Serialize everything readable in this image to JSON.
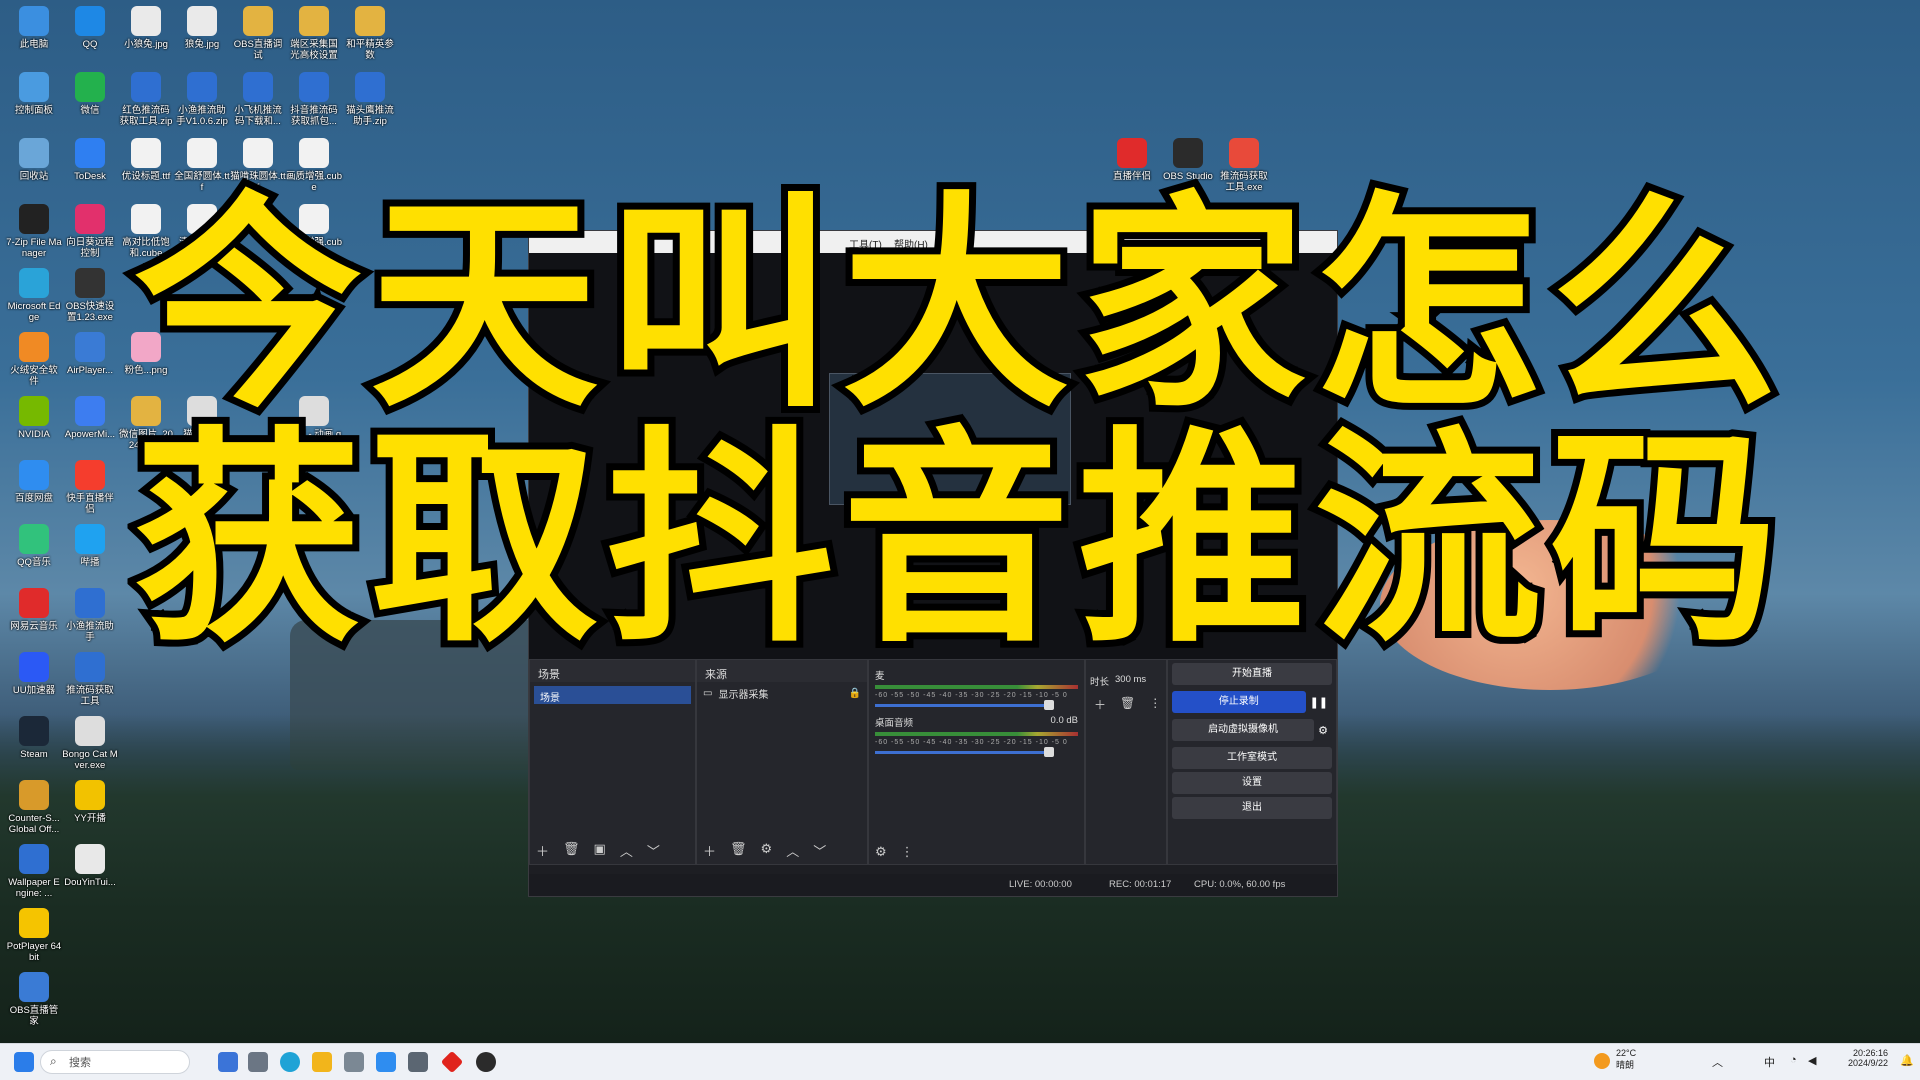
{
  "desktop_icons": [
    {
      "label": "此电脑",
      "color": "#3b8fe0"
    },
    {
      "label": "QQ",
      "color": "#1e88e5"
    },
    {
      "label": "小狼兔.jpg",
      "color": "#eaeaea"
    },
    {
      "label": "狼兔.jpg",
      "color": "#eaeaea"
    },
    {
      "label": "OBS直播调试",
      "color": "#e3b341"
    },
    {
      "label": "端区采集国光高校设置",
      "color": "#e3b341"
    },
    {
      "label": "和平精英参数",
      "color": "#e3b341"
    },
    {
      "label": "控制面板",
      "color": "#4a9be0"
    },
    {
      "label": "微信",
      "color": "#23b14d"
    },
    {
      "label": "红色推流码获取工具.zip",
      "color": "#2f6fd1"
    },
    {
      "label": "小渔推流助手V1.0.6.zip",
      "color": "#2f6fd1"
    },
    {
      "label": "小飞机推流码下载和...",
      "color": "#2f6fd1"
    },
    {
      "label": "抖音推流码获取抓包...",
      "color": "#2f6fd1"
    },
    {
      "label": "猫头鹰推流助手.zip",
      "color": "#2f6fd1"
    },
    {
      "label": "回收站",
      "color": "#6aa6d8"
    },
    {
      "label": "ToDesk",
      "color": "#2f7ff1"
    },
    {
      "label": "优设标题.ttf",
      "color": "#f2f2f2"
    },
    {
      "label": "全国舒圆体.ttf",
      "color": "#f2f2f2"
    },
    {
      "label": "猫啃珠圆体.ttf",
      "color": "#f2f2f2"
    },
    {
      "label": "画质增强.cube",
      "color": "#f2f2f2"
    },
    {
      "label": "7-Zip File Manager",
      "color": "#222"
    },
    {
      "label": "向日葵远程控制",
      "color": "#e2306c"
    },
    {
      "label": "高对比低饱和.cube",
      "color": "#f2f2f2"
    },
    {
      "label": "清新暖调...",
      "color": "#f2f2f2"
    },
    {
      "label": "画质增强.cube",
      "color": "#f2f2f2"
    },
    {
      "label": "Microsoft Edge",
      "color": "#2aa3d8"
    },
    {
      "label": "OBS快速设置1.23.exe",
      "color": "#333"
    },
    {
      "label": "火绒安全软件",
      "color": "#f08a24"
    },
    {
      "label": "AirPlayer...",
      "color": "#3a7bd5"
    },
    {
      "label": "粉色...png",
      "color": "#f2a7c7"
    },
    {
      "label": "NVIDIA",
      "color": "#76b900"
    },
    {
      "label": "ApowerMi...",
      "color": "#3d7df0"
    },
    {
      "label": "微信图片_2024030...",
      "color": "#e3b341"
    },
    {
      "label": "猫咪.GIF",
      "color": "#ddd"
    },
    {
      "label": "画面 - 动画.gif",
      "color": "#ddd"
    },
    {
      "label": "百度网盘",
      "color": "#2f8df0"
    },
    {
      "label": "快手直播伴侣",
      "color": "#f53d2d"
    },
    {
      "label": "QQ音乐",
      "color": "#31c27c"
    },
    {
      "label": "哔播",
      "color": "#1fa2f0"
    },
    {
      "label": "网易云音乐",
      "color": "#e02b2b"
    },
    {
      "label": "小渔推流助手",
      "color": "#2f6fd1"
    },
    {
      "label": "UU加速器",
      "color": "#2b59f5"
    },
    {
      "label": "推流码获取工具",
      "color": "#2f6fd1"
    },
    {
      "label": "Steam",
      "color": "#1b2838"
    },
    {
      "label": "Bongo Cat Mver.exe",
      "color": "#ddd"
    },
    {
      "label": "Counter-S... Global Off...",
      "color": "#d89a2a"
    },
    {
      "label": "YY开播",
      "color": "#f2c200"
    },
    {
      "label": "Wallpaper Engine: ...",
      "color": "#2f6fd1"
    },
    {
      "label": "DouYinTui...",
      "color": "#e8e8e8"
    },
    {
      "label": "PotPlayer 64 bit",
      "color": "#f5c400"
    },
    {
      "label": "OBS直播管家",
      "color": "#3a7bd5"
    },
    {
      "label": "直播伴侣",
      "color": "#e02b2b"
    },
    {
      "label": "OBS Studio",
      "color": "#2b2b2b"
    },
    {
      "label": "推流码获取工具.exe",
      "color": "#e84a3a"
    }
  ],
  "obs": {
    "menu": [
      "工具(T)",
      "帮助(H)"
    ],
    "scenes_title": "场景",
    "scene_selected": "场景",
    "sources_title": "来源",
    "source_item": "显示器采集",
    "mixer": {
      "track1_name": "麦",
      "track2_name": "桌面音频",
      "track2_db": "0.0 dB",
      "scale": "-60 -55 -50 -45 -40 -35 -30 -25 -20 -15 -10 -5 0"
    },
    "transition": {
      "duration_label": "时长",
      "duration_value": "300 ms"
    },
    "controls": {
      "start_stream": "开始直播",
      "stop_record": "停止录制",
      "virtual_cam": "启动虚拟摄像机",
      "studio_mode": "工作室模式",
      "settings": "设置",
      "exit": "退出"
    },
    "status": {
      "live": "LIVE: 00:00:00",
      "rec": "REC: 00:01:17",
      "cpu": "CPU: 0.0%, 60.00 fps"
    }
  },
  "headline": {
    "line1": "今天叫大家怎么",
    "line2": "获取抖音推流码"
  },
  "taskbar": {
    "search_placeholder": "搜索",
    "weather_temp": "22°C",
    "weather_desc": "晴朗",
    "tray_ime": "中",
    "time": "20:26:16",
    "date": "2024/9/22"
  },
  "colors": {
    "headline_fill": "#ffe000",
    "obs_accent": "#2450c8"
  }
}
